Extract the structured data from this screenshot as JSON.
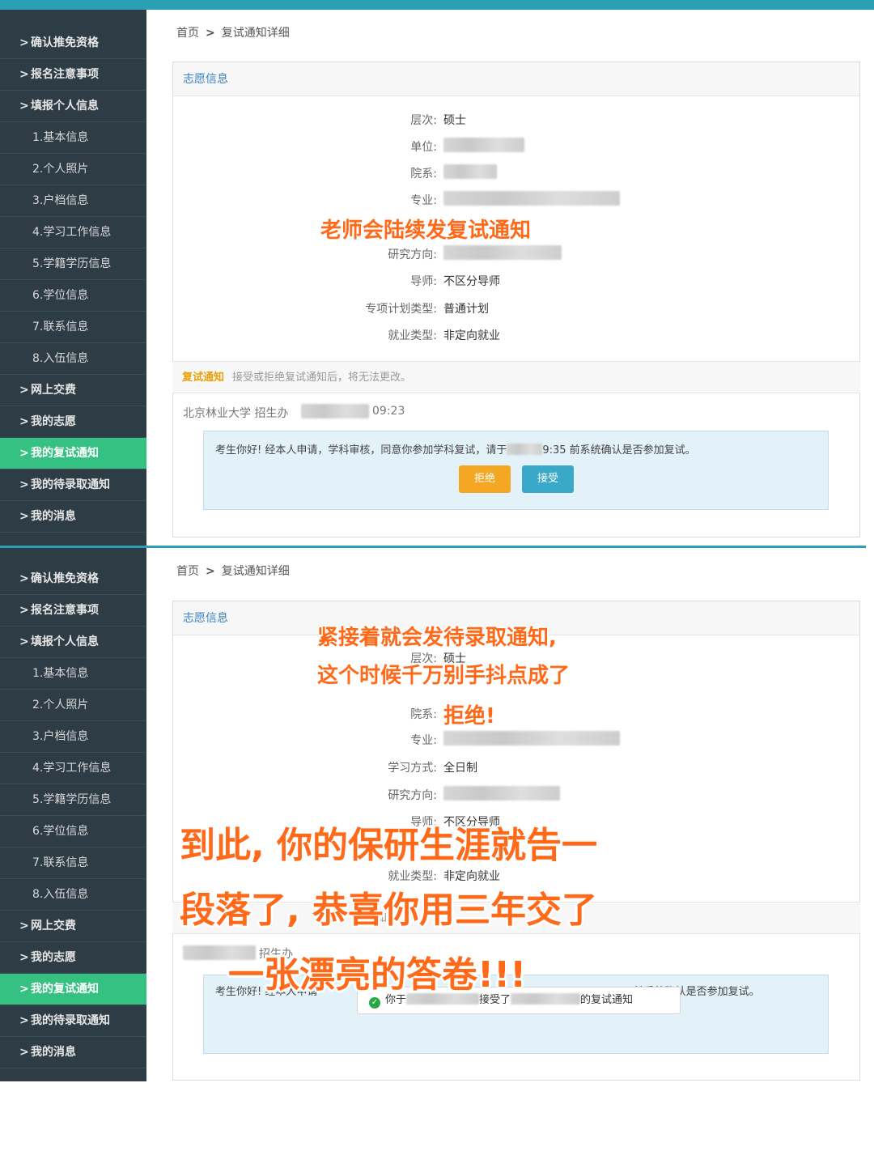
{
  "colors": {
    "sidebar_bg": "#2e3c46",
    "active_item": "#35c182",
    "topbar": "#2ba0b5",
    "section_title": "#3a82c6",
    "notice_tag": "#e8a10a",
    "reject_btn": "#f5a623",
    "accept_btn": "#3aa9c9",
    "overlay_text": "#ff6a1a"
  },
  "sidebar": {
    "items": [
      {
        "label": "确认推免资格"
      },
      {
        "label": "报名注意事项"
      },
      {
        "label": "填报个人信息"
      },
      {
        "label": "1.基本信息"
      },
      {
        "label": "2.个人照片"
      },
      {
        "label": "3.户档信息"
      },
      {
        "label": "4.学习工作信息"
      },
      {
        "label": "5.学籍学历信息"
      },
      {
        "label": "6.学位信息"
      },
      {
        "label": "7.联系信息"
      },
      {
        "label": "8.入伍信息"
      },
      {
        "label": "网上交费"
      },
      {
        "label": "我的志愿"
      },
      {
        "label": "我的复试通知"
      },
      {
        "label": "我的待录取通知"
      },
      {
        "label": "我的消息"
      }
    ],
    "chevron": ">"
  },
  "breadcrumb": {
    "home": "首页",
    "separator": ">",
    "current": "复试通知详细"
  },
  "panel1": {
    "section_title": "志愿信息",
    "fields": {
      "level_label": "层次:",
      "level_value": "硕士",
      "unit_label": "单位:",
      "dept_label": "院系:",
      "major_label": "专业:",
      "direction_label": "研究方向:",
      "advisor_label": "导师:",
      "advisor_value": "不区分导师",
      "plan_label": "专项计划类型:",
      "plan_value": "普通计划",
      "employ_label": "就业类型:",
      "employ_value": "非定向就业"
    },
    "notice_tag": "复试通知",
    "notice_tip": "接受或拒绝复试通知后，将无法更改。",
    "sender": "北京林业大学 招生办",
    "sent_time": "09:23",
    "message_start": "考生你好! 经本人申请，学科审核，同意你参加学科复试，请于",
    "message_end": "9:35 前系统确认是否参加复试。",
    "reject_label": "拒绝",
    "accept_label": "接受",
    "overlay_text": "老师会陆续发复试通知"
  },
  "panel2": {
    "section_title": "志愿信息",
    "fields": {
      "level_label": "层次:",
      "level_value": "硕士",
      "dept_label": "院系:",
      "major_label": "专业:",
      "study_label": "学习方式:",
      "study_value": "全日制",
      "direction_label": "研究方向:",
      "advisor_label": "导师:",
      "advisor_value": "不区分导师",
      "employ_label": "就业类型:",
      "employ_value": "非定向就业"
    },
    "notice_tip": "知后,",
    "sender": "招生办",
    "message_start": "考生你好! 经本人申请",
    "message_end": "35 前系统确认是否参加复试。",
    "accepted_prefix": "你于",
    "accepted_mid": "接受了",
    "accepted_suffix": "的复试通知",
    "overlay_line1": "紧接着就会发待录取通知,",
    "overlay_line2": "这个时候千万别手抖点成了",
    "overlay_line3": "拒绝!",
    "overlay_big1": "到此, 你的保研生涯就告一",
    "overlay_big2": "段落了, 恭喜你用三年交了",
    "overlay_big3": "一张漂亮的答卷!!!"
  }
}
